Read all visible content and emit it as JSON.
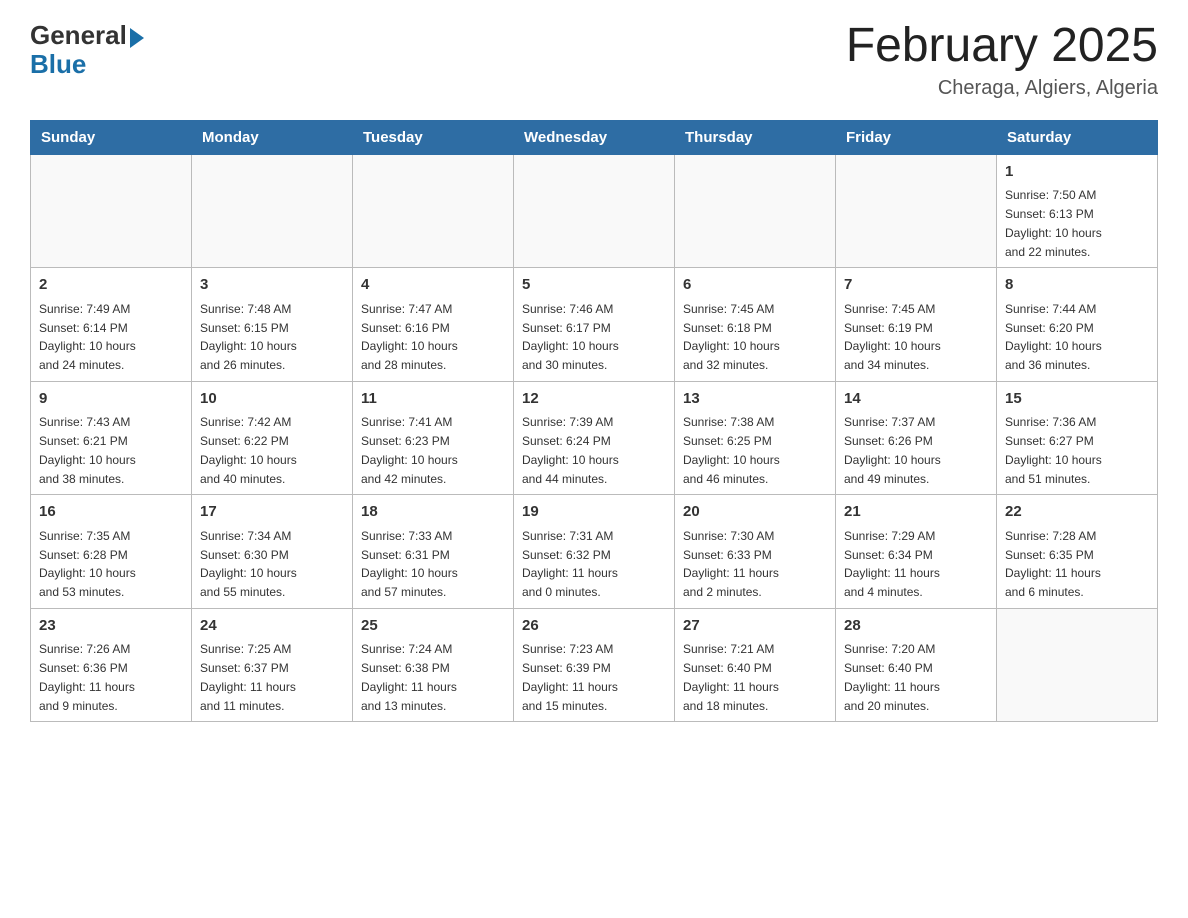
{
  "logo": {
    "general": "General",
    "blue": "Blue"
  },
  "title": "February 2025",
  "subtitle": "Cheraga, Algiers, Algeria",
  "days_header": [
    "Sunday",
    "Monday",
    "Tuesday",
    "Wednesday",
    "Thursday",
    "Friday",
    "Saturday"
  ],
  "weeks": [
    [
      {
        "day": "",
        "info": ""
      },
      {
        "day": "",
        "info": ""
      },
      {
        "day": "",
        "info": ""
      },
      {
        "day": "",
        "info": ""
      },
      {
        "day": "",
        "info": ""
      },
      {
        "day": "",
        "info": ""
      },
      {
        "day": "1",
        "info": "Sunrise: 7:50 AM\nSunset: 6:13 PM\nDaylight: 10 hours\nand 22 minutes."
      }
    ],
    [
      {
        "day": "2",
        "info": "Sunrise: 7:49 AM\nSunset: 6:14 PM\nDaylight: 10 hours\nand 24 minutes."
      },
      {
        "day": "3",
        "info": "Sunrise: 7:48 AM\nSunset: 6:15 PM\nDaylight: 10 hours\nand 26 minutes."
      },
      {
        "day": "4",
        "info": "Sunrise: 7:47 AM\nSunset: 6:16 PM\nDaylight: 10 hours\nand 28 minutes."
      },
      {
        "day": "5",
        "info": "Sunrise: 7:46 AM\nSunset: 6:17 PM\nDaylight: 10 hours\nand 30 minutes."
      },
      {
        "day": "6",
        "info": "Sunrise: 7:45 AM\nSunset: 6:18 PM\nDaylight: 10 hours\nand 32 minutes."
      },
      {
        "day": "7",
        "info": "Sunrise: 7:45 AM\nSunset: 6:19 PM\nDaylight: 10 hours\nand 34 minutes."
      },
      {
        "day": "8",
        "info": "Sunrise: 7:44 AM\nSunset: 6:20 PM\nDaylight: 10 hours\nand 36 minutes."
      }
    ],
    [
      {
        "day": "9",
        "info": "Sunrise: 7:43 AM\nSunset: 6:21 PM\nDaylight: 10 hours\nand 38 minutes."
      },
      {
        "day": "10",
        "info": "Sunrise: 7:42 AM\nSunset: 6:22 PM\nDaylight: 10 hours\nand 40 minutes."
      },
      {
        "day": "11",
        "info": "Sunrise: 7:41 AM\nSunset: 6:23 PM\nDaylight: 10 hours\nand 42 minutes."
      },
      {
        "day": "12",
        "info": "Sunrise: 7:39 AM\nSunset: 6:24 PM\nDaylight: 10 hours\nand 44 minutes."
      },
      {
        "day": "13",
        "info": "Sunrise: 7:38 AM\nSunset: 6:25 PM\nDaylight: 10 hours\nand 46 minutes."
      },
      {
        "day": "14",
        "info": "Sunrise: 7:37 AM\nSunset: 6:26 PM\nDaylight: 10 hours\nand 49 minutes."
      },
      {
        "day": "15",
        "info": "Sunrise: 7:36 AM\nSunset: 6:27 PM\nDaylight: 10 hours\nand 51 minutes."
      }
    ],
    [
      {
        "day": "16",
        "info": "Sunrise: 7:35 AM\nSunset: 6:28 PM\nDaylight: 10 hours\nand 53 minutes."
      },
      {
        "day": "17",
        "info": "Sunrise: 7:34 AM\nSunset: 6:30 PM\nDaylight: 10 hours\nand 55 minutes."
      },
      {
        "day": "18",
        "info": "Sunrise: 7:33 AM\nSunset: 6:31 PM\nDaylight: 10 hours\nand 57 minutes."
      },
      {
        "day": "19",
        "info": "Sunrise: 7:31 AM\nSunset: 6:32 PM\nDaylight: 11 hours\nand 0 minutes."
      },
      {
        "day": "20",
        "info": "Sunrise: 7:30 AM\nSunset: 6:33 PM\nDaylight: 11 hours\nand 2 minutes."
      },
      {
        "day": "21",
        "info": "Sunrise: 7:29 AM\nSunset: 6:34 PM\nDaylight: 11 hours\nand 4 minutes."
      },
      {
        "day": "22",
        "info": "Sunrise: 7:28 AM\nSunset: 6:35 PM\nDaylight: 11 hours\nand 6 minutes."
      }
    ],
    [
      {
        "day": "23",
        "info": "Sunrise: 7:26 AM\nSunset: 6:36 PM\nDaylight: 11 hours\nand 9 minutes."
      },
      {
        "day": "24",
        "info": "Sunrise: 7:25 AM\nSunset: 6:37 PM\nDaylight: 11 hours\nand 11 minutes."
      },
      {
        "day": "25",
        "info": "Sunrise: 7:24 AM\nSunset: 6:38 PM\nDaylight: 11 hours\nand 13 minutes."
      },
      {
        "day": "26",
        "info": "Sunrise: 7:23 AM\nSunset: 6:39 PM\nDaylight: 11 hours\nand 15 minutes."
      },
      {
        "day": "27",
        "info": "Sunrise: 7:21 AM\nSunset: 6:40 PM\nDaylight: 11 hours\nand 18 minutes."
      },
      {
        "day": "28",
        "info": "Sunrise: 7:20 AM\nSunset: 6:40 PM\nDaylight: 11 hours\nand 20 minutes."
      },
      {
        "day": "",
        "info": ""
      }
    ]
  ]
}
